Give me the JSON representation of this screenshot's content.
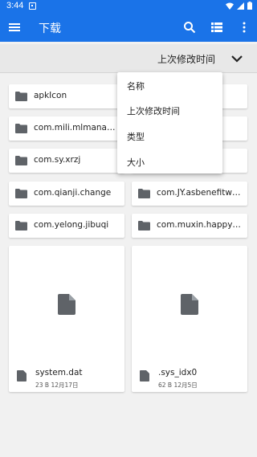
{
  "status": {
    "time": "3:44"
  },
  "appbar": {
    "title": "下载"
  },
  "sort": {
    "label": "上次修改时间"
  },
  "menu": {
    "items": [
      {
        "label": "名称"
      },
      {
        "label": "上次修改时间"
      },
      {
        "label": "类型"
      },
      {
        "label": "大小"
      }
    ]
  },
  "folders": [
    {
      "name": "apkIcon"
    },
    {
      "name": ""
    },
    {
      "name": "com.mili.mlmanager"
    },
    {
      "name": ""
    },
    {
      "name": "com.sy.xrzj"
    },
    {
      "name": ""
    },
    {
      "name": "com.qianji.change"
    },
    {
      "name": "com.JY.asbenefitwal..."
    },
    {
      "name": "com.yelong.jibuqi"
    },
    {
      "name": "com.muxin.happysp..."
    }
  ],
  "files": [
    {
      "name": "system.dat",
      "meta": "23 B 12月17日"
    },
    {
      "name": ".sys_idx0",
      "meta": "62 B 12月5日"
    }
  ],
  "colors": {
    "primary": "#1a73e8",
    "icon": "#5f6368"
  }
}
